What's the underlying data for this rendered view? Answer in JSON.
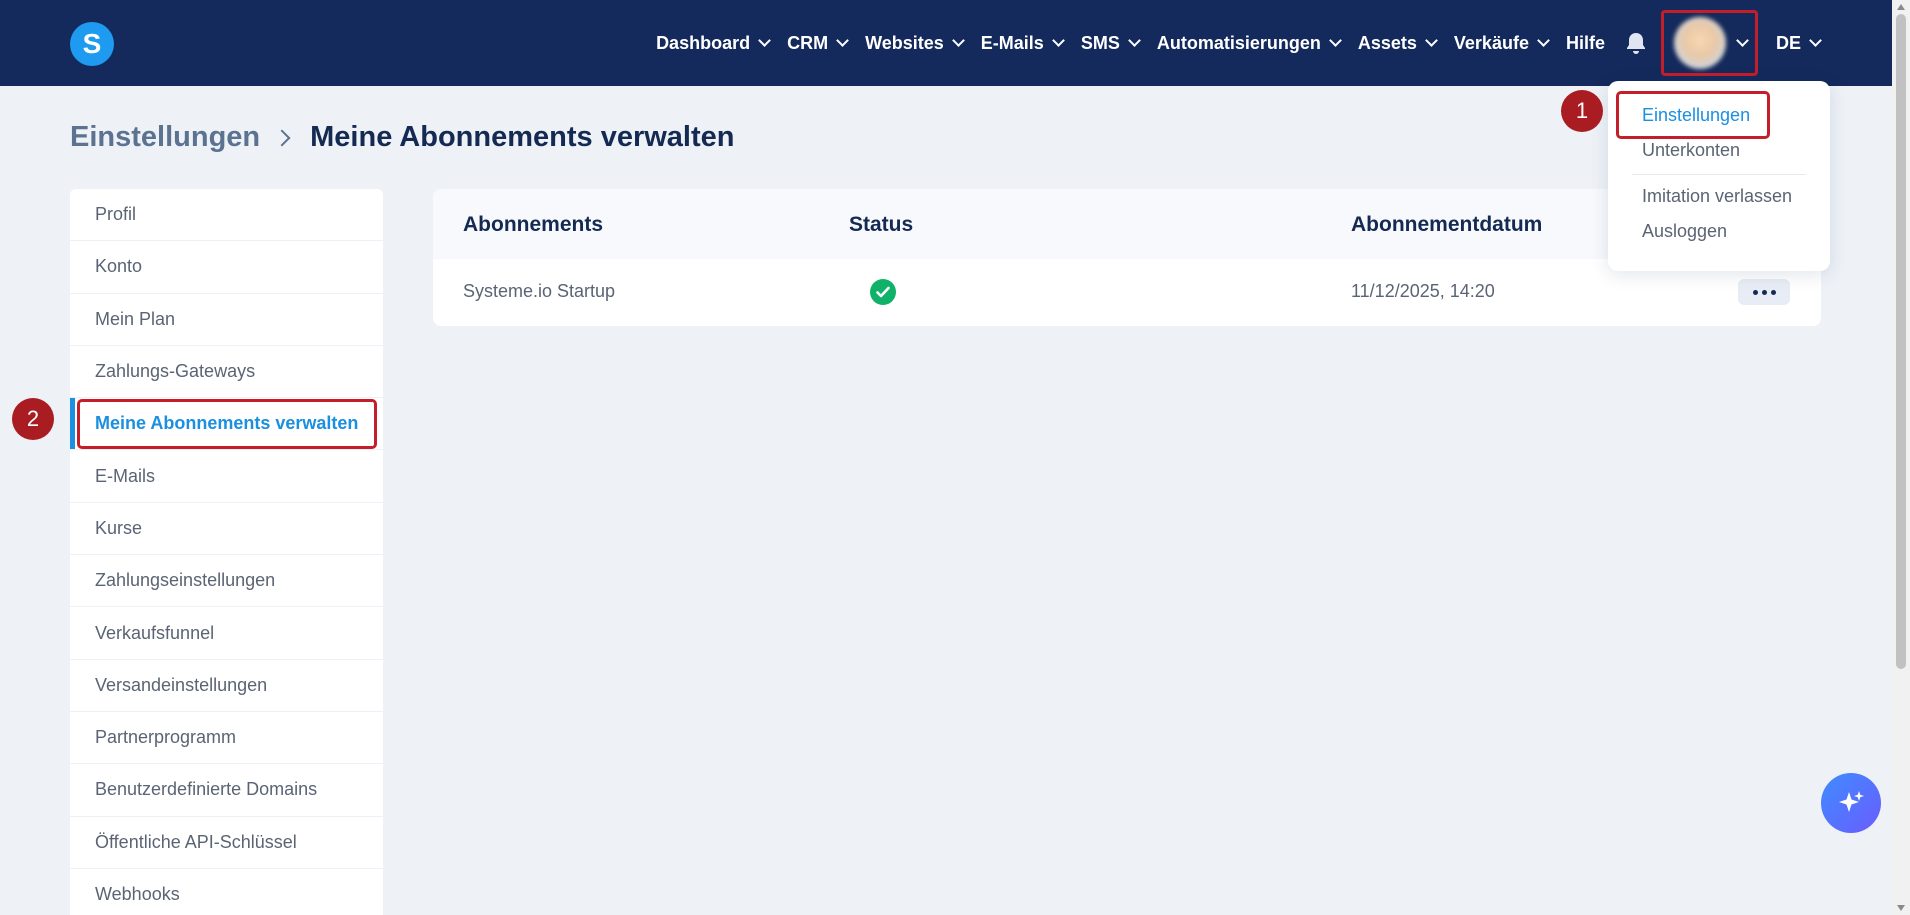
{
  "brand": {
    "logo_letter": "S",
    "color": "#1e9bf0"
  },
  "nav": {
    "items": [
      {
        "label": "Dashboard",
        "has_dropdown": true
      },
      {
        "label": "CRM",
        "has_dropdown": true
      },
      {
        "label": "Websites",
        "has_dropdown": true
      },
      {
        "label": "E-Mails",
        "has_dropdown": true
      },
      {
        "label": "SMS",
        "has_dropdown": true
      },
      {
        "label": "Automatisierungen",
        "has_dropdown": true
      },
      {
        "label": "Assets",
        "has_dropdown": true
      },
      {
        "label": "Verkäufe",
        "has_dropdown": true
      },
      {
        "label": "Hilfe",
        "has_dropdown": false
      }
    ],
    "language": "DE",
    "bg_color": "#142a5c"
  },
  "breadcrumb": {
    "parent": "Einstellungen",
    "current": "Meine Abonnements verwalten"
  },
  "sidebar": {
    "items": [
      {
        "label": "Profil"
      },
      {
        "label": "Konto"
      },
      {
        "label": "Mein Plan"
      },
      {
        "label": "Zahlungs-Gateways"
      },
      {
        "label": "Meine Abonnements verwalten",
        "active": true
      },
      {
        "label": "E-Mails"
      },
      {
        "label": "Kurse"
      },
      {
        "label": "Zahlungseinstellungen"
      },
      {
        "label": "Verkaufsfunnel"
      },
      {
        "label": "Versandeinstellungen"
      },
      {
        "label": "Partnerprogramm"
      },
      {
        "label": "Benutzerdefinierte Domains"
      },
      {
        "label": "Öffentliche API-Schlüssel"
      },
      {
        "label": "Webhooks"
      }
    ],
    "active_color": "#1b8fe0"
  },
  "table": {
    "headers": {
      "subscriptions": "Abonnements",
      "status": "Status",
      "date": "Abonnementdatum"
    },
    "rows": [
      {
        "subscription": "Systeme.io Startup",
        "status": "active",
        "date": "11/12/2025, 14:20"
      }
    ],
    "status_color": "#10b26a"
  },
  "user_menu": {
    "items": [
      {
        "label": "Einstellungen",
        "active": true
      },
      {
        "label": "Unterkonten"
      },
      {
        "label": "Imitation verlassen"
      },
      {
        "label": "Ausloggen"
      }
    ]
  },
  "annotations": {
    "step1": "1",
    "step2": "2",
    "highlight_color": "#c41e2a"
  },
  "icons": [
    "bell-icon",
    "chevron-down-icon",
    "check-circle-icon",
    "more-horizontal-icon",
    "sparkle-icon"
  ]
}
